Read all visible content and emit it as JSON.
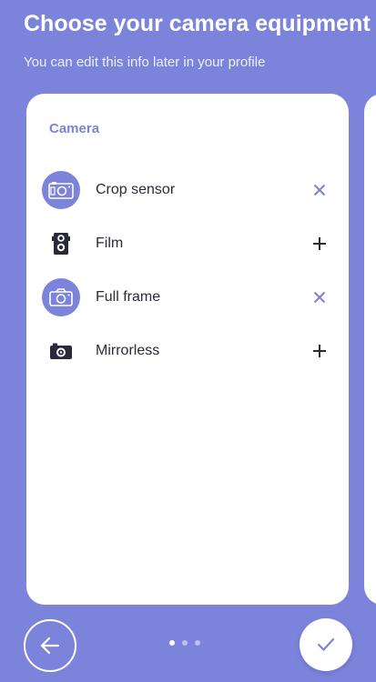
{
  "colors": {
    "background": "#7b83db",
    "accent": "#7b83db",
    "text": "#2a2a3a",
    "card": "#ffffff"
  },
  "header": {
    "title": "Choose your camera equipment",
    "subtitle": "You can edit this info later in your profile"
  },
  "card": {
    "section_title": "Camera",
    "items": [
      {
        "label": "Crop sensor",
        "icon": "crop-sensor-camera-icon",
        "selected": true,
        "action": "remove-icon"
      },
      {
        "label": "Film",
        "icon": "film-camera-icon",
        "selected": false,
        "action": "add-icon"
      },
      {
        "label": "Full frame",
        "icon": "full-frame-camera-icon",
        "selected": true,
        "action": "remove-icon"
      },
      {
        "label": "Mirrorless",
        "icon": "mirrorless-camera-icon",
        "selected": false,
        "action": "add-icon"
      }
    ]
  },
  "footer": {
    "back_icon": "arrow-left-icon",
    "confirm_icon": "check-icon",
    "page_count": 3,
    "active_page": 1
  }
}
